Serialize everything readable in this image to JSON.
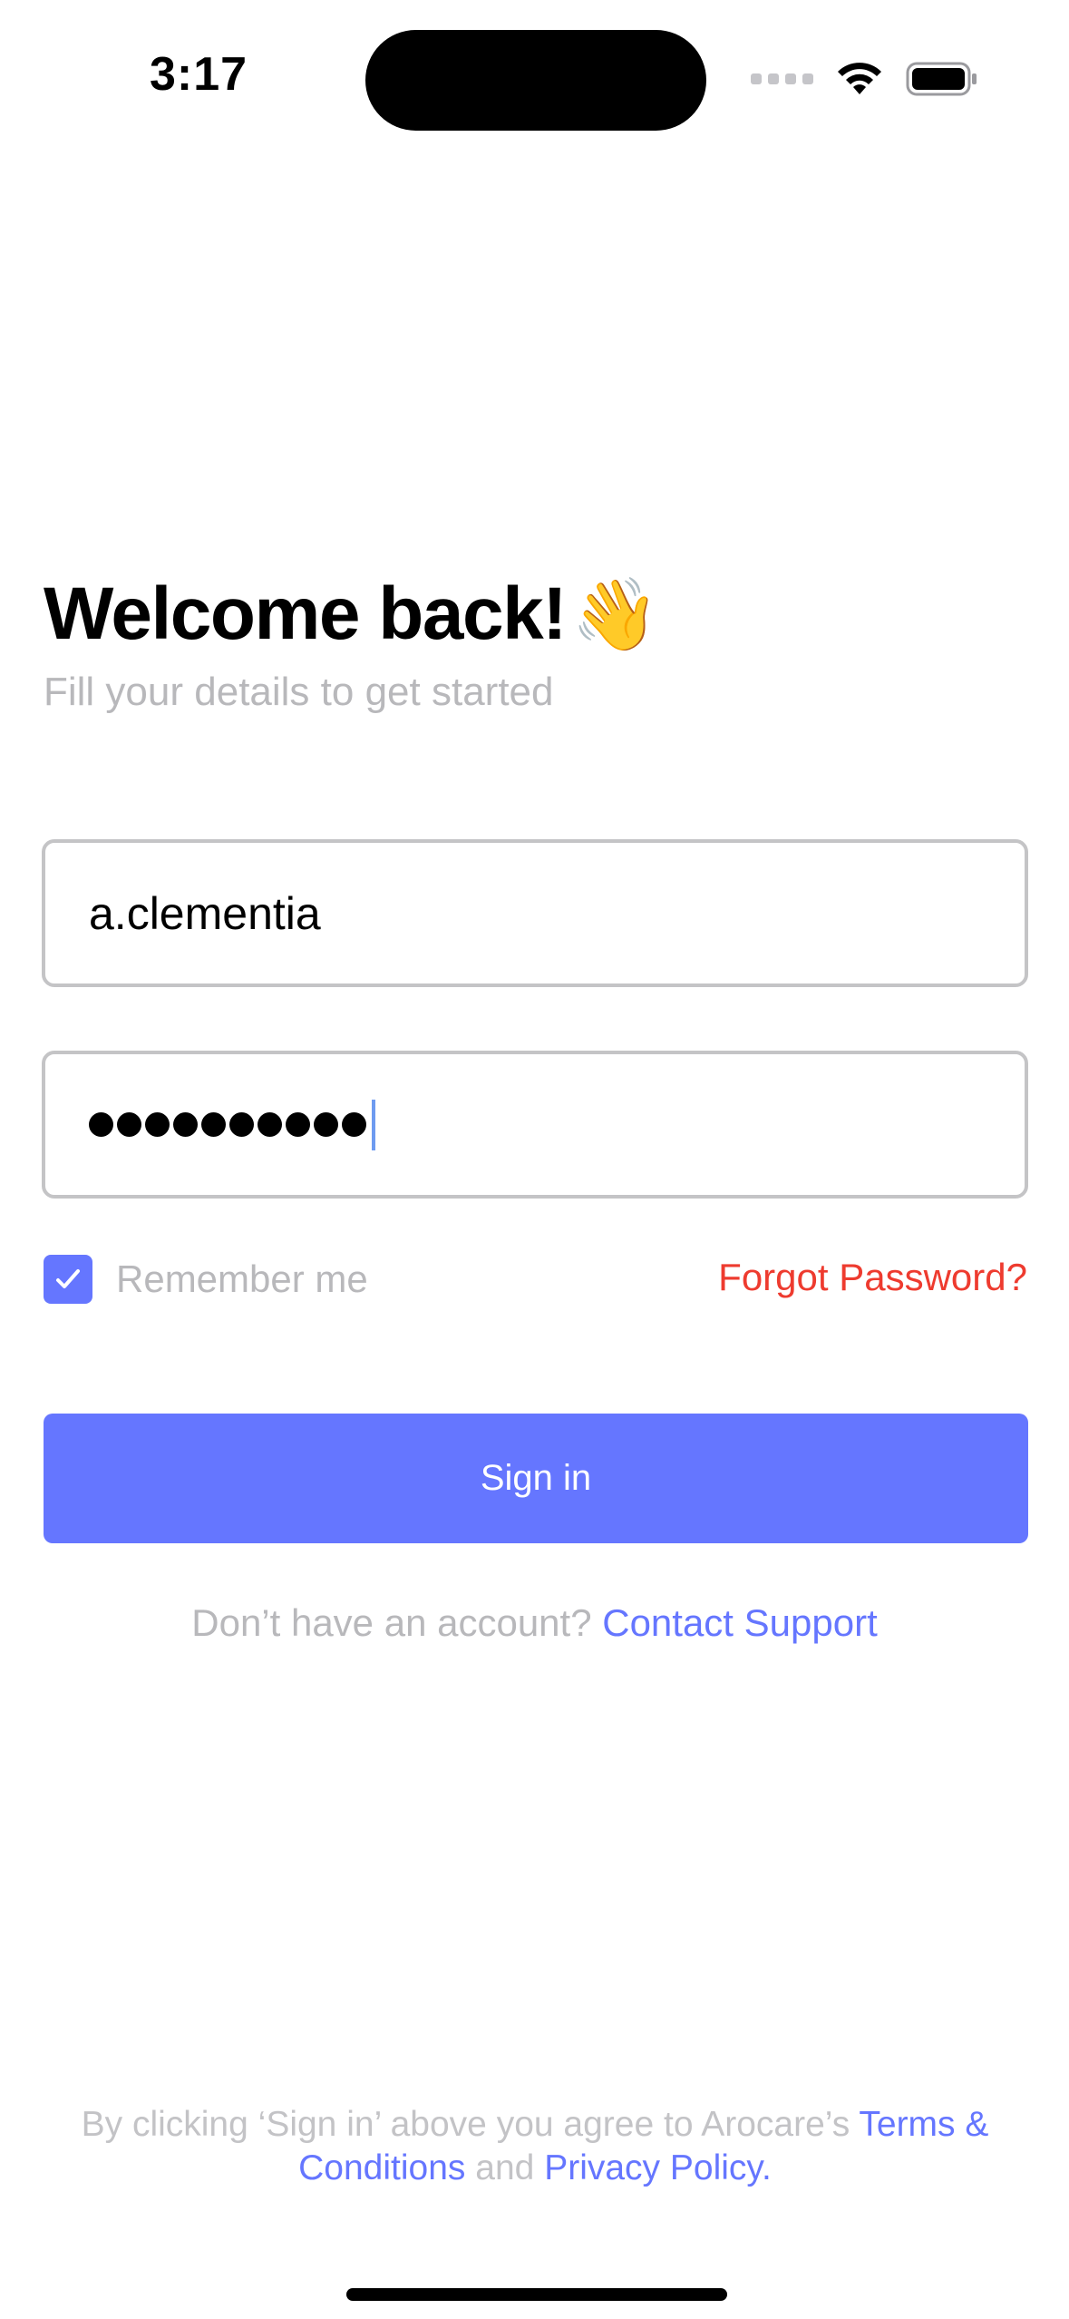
{
  "status_bar": {
    "time": "3:17",
    "icons": [
      "cellular-signal-icon",
      "wifi-icon",
      "battery-icon"
    ]
  },
  "header": {
    "title": "Welcome back!",
    "title_emoji": "👋",
    "subtitle": "Fill your details to get started"
  },
  "form": {
    "username_value": "a.clementia",
    "password_masked_length": 10,
    "remember_me_label": "Remember me",
    "remember_me_checked": true,
    "forgot_password_label": "Forgot Password?",
    "signin_label": "Sign in"
  },
  "account": {
    "prompt": "Don’t have an account?",
    "contact_support_label": "Contact Support"
  },
  "footer": {
    "prefix": "By clicking ‘Sign in’ above you agree to Arocare’s",
    "terms_label": "Terms & Conditions",
    "and_text": "and",
    "privacy_label": "Privacy Policy."
  },
  "colors": {
    "accent": "#6576ff",
    "danger": "#ee3b2f",
    "muted_text": "#b8b8bb",
    "field_border": "#c4c4c6"
  }
}
